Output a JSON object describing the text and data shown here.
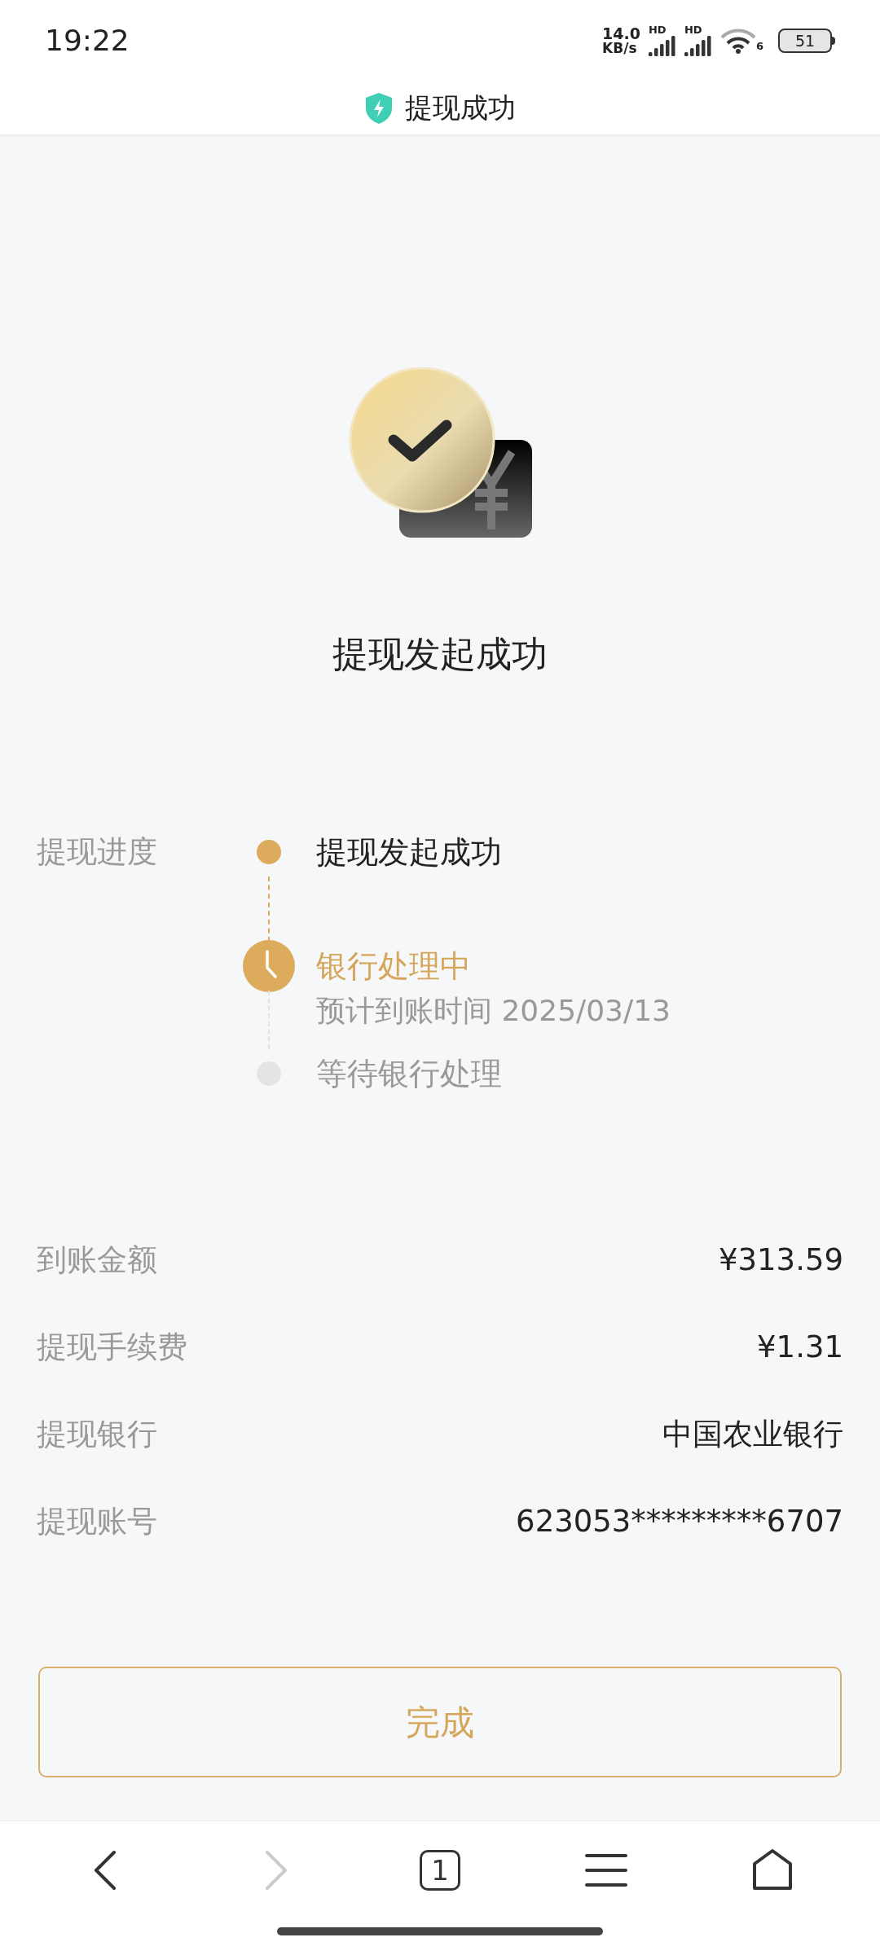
{
  "status_bar": {
    "time": "19:22",
    "speed_value": "14.0",
    "speed_unit": "KB/s",
    "sim_labels": [
      "HD",
      "HD"
    ],
    "wifi_label": "6",
    "battery": "51"
  },
  "header": {
    "title": "提现成功"
  },
  "result": {
    "title": "提现发起成功"
  },
  "progress": {
    "label": "提现进度",
    "steps": [
      {
        "kind": "done",
        "title": "提现发起成功"
      },
      {
        "kind": "current",
        "title": "银行处理中",
        "subtitle": "预计到账时间 2025/03/13"
      },
      {
        "kind": "pending",
        "title": "等待银行处理"
      }
    ]
  },
  "details": [
    {
      "label": "到账金额",
      "value": "¥313.59"
    },
    {
      "label": "提现手续费",
      "value": "¥1.31"
    },
    {
      "label": "提现银行",
      "value": "中国农业银行"
    },
    {
      "label": "提现账号",
      "value": "623053*********6707"
    }
  ],
  "done_button": "完成",
  "browser_nav": [
    {
      "kind": "back",
      "disabled": false
    },
    {
      "kind": "forward",
      "disabled": true
    },
    {
      "kind": "tabs",
      "label": "1",
      "disabled": false
    },
    {
      "kind": "menu",
      "disabled": false
    },
    {
      "kind": "home",
      "disabled": false
    }
  ]
}
